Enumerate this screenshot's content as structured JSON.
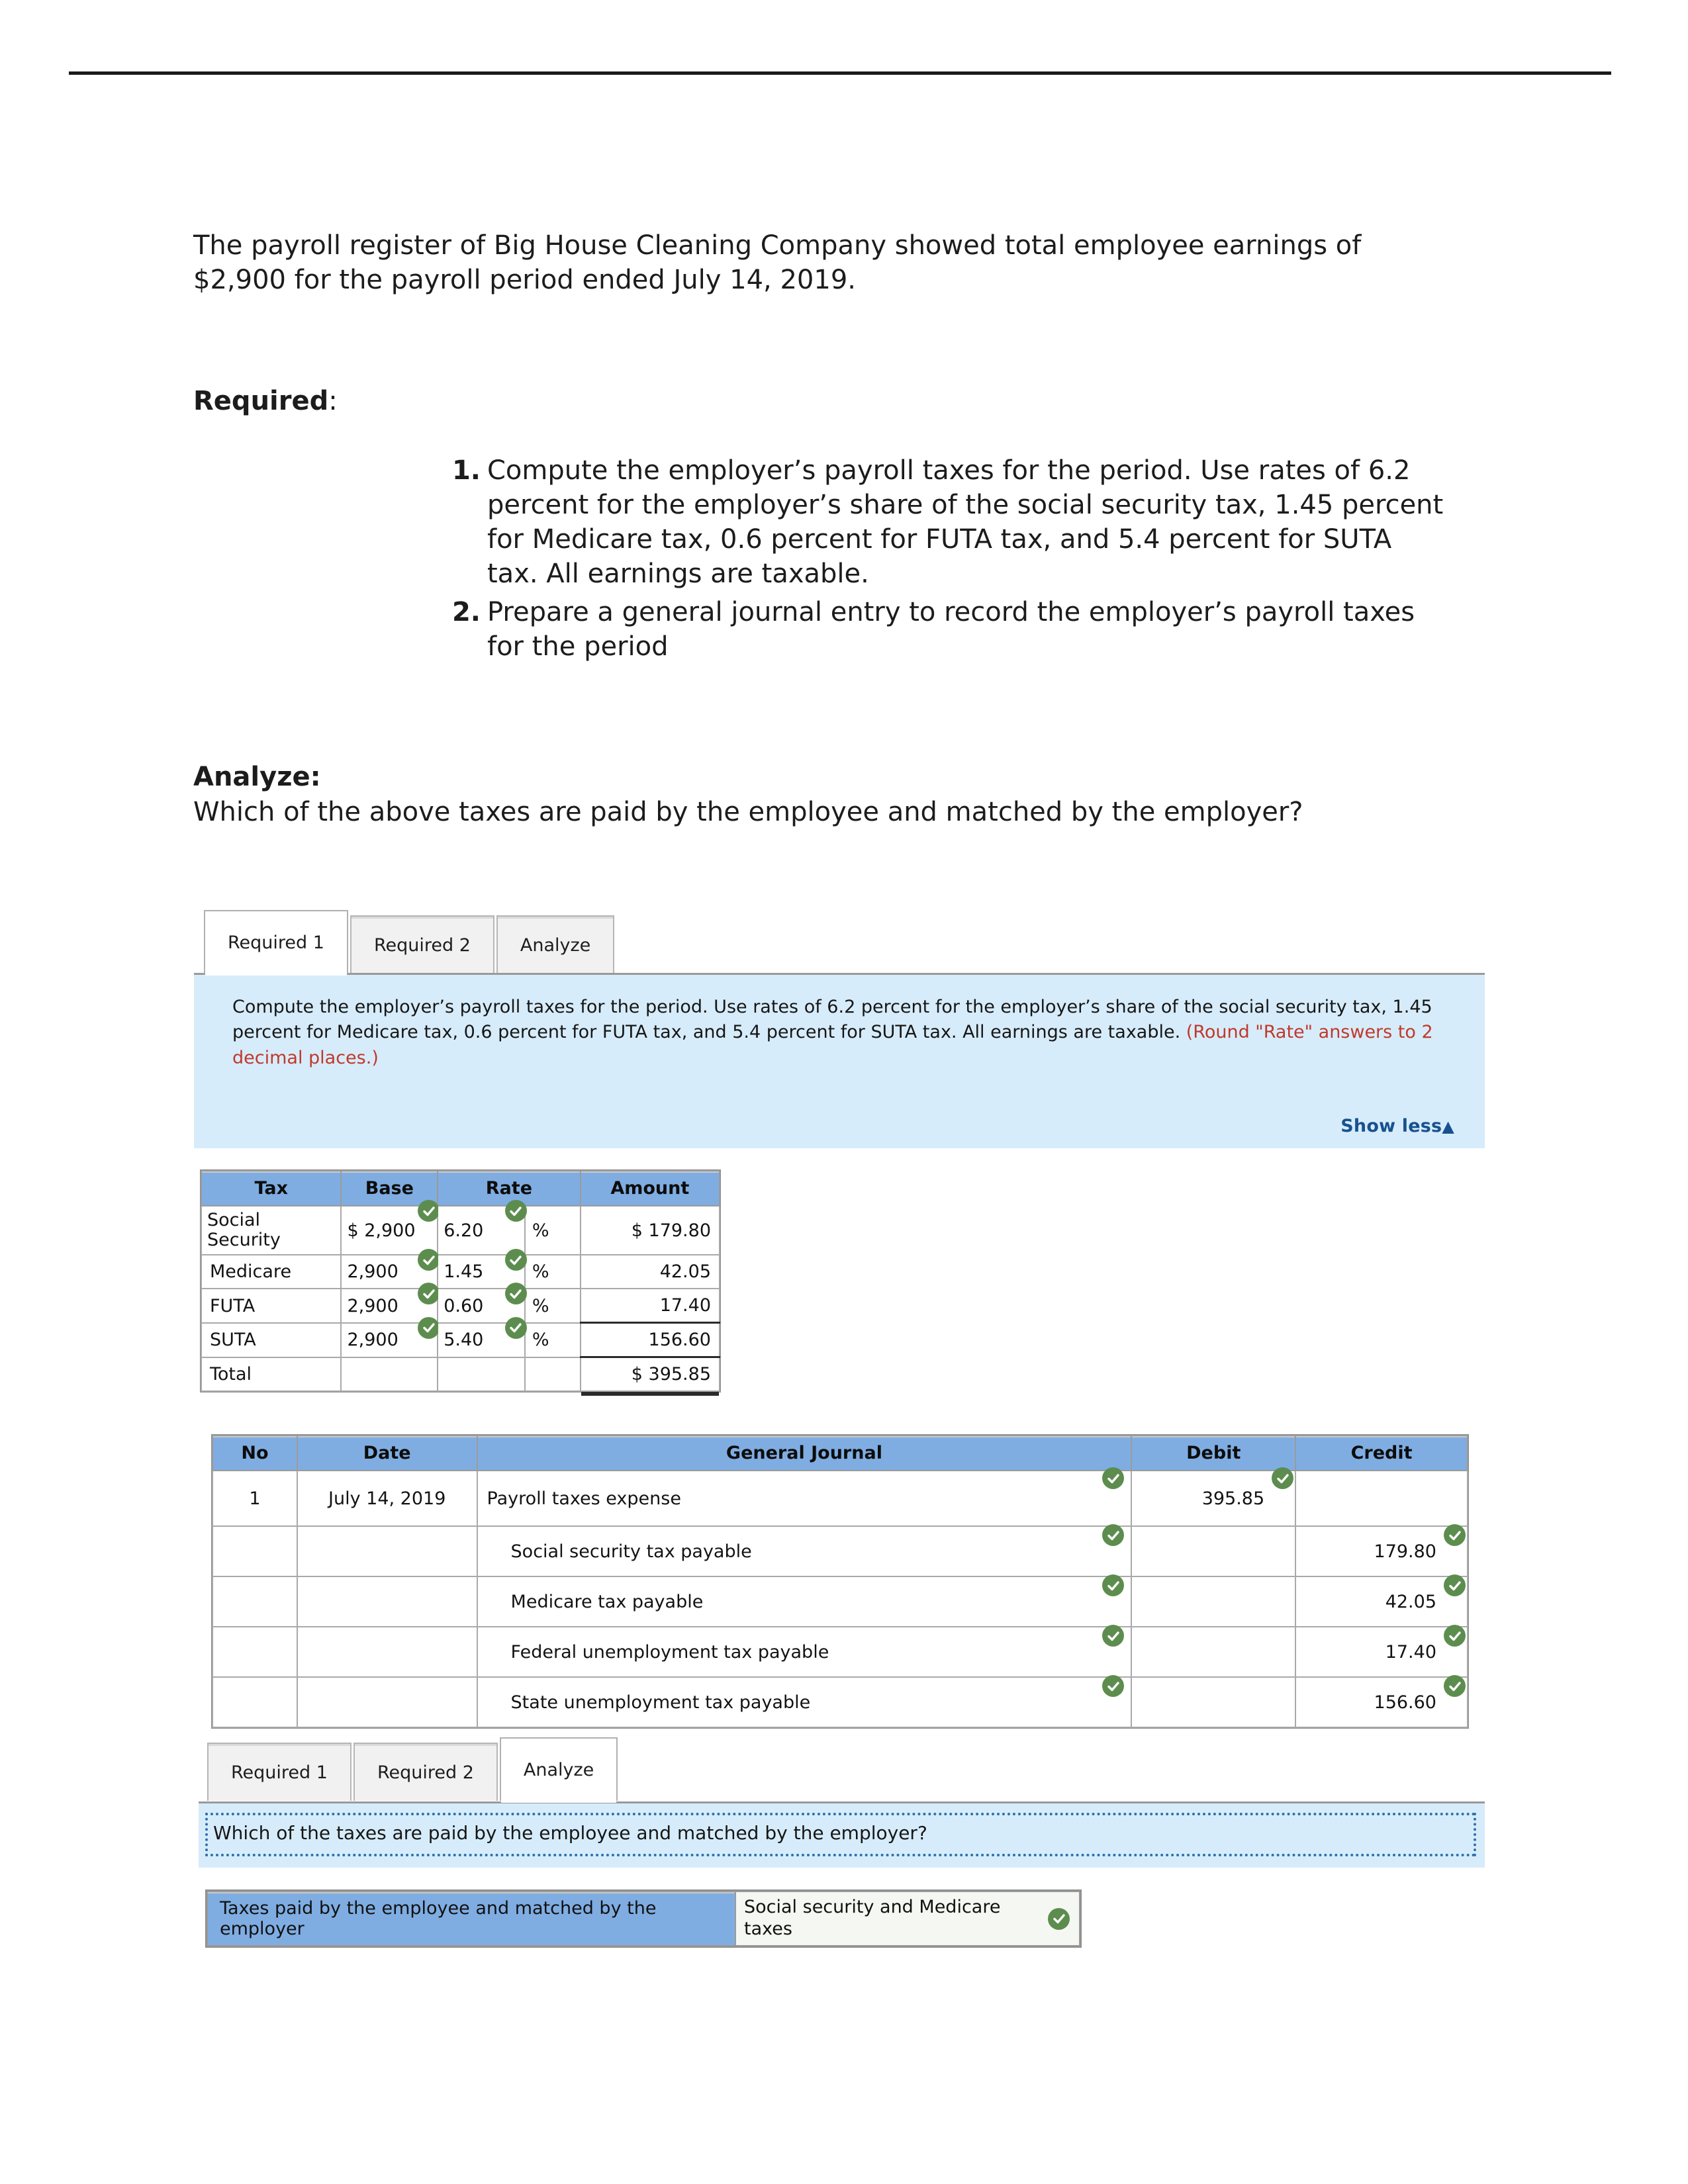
{
  "document": {
    "intro": "The payroll register of Big House Cleaning Company showed total employee earnings of $2,900 for the payroll period ended July 14, 2019.",
    "required_label": "Required",
    "required_colon": ":",
    "requirements": [
      {
        "num": "1.",
        "text": "Compute the employer’s payroll taxes for the period. Use rates of 6.2 percent for the employer’s share of the social security tax, 1.45 percent for Medicare tax, 0.6 percent for FUTA tax, and 5.4 percent for SUTA tax. All earnings are taxable."
      },
      {
        "num": "2.",
        "text": "Prepare a general journal entry to record the employer’s payroll taxes for the period"
      }
    ],
    "analyze_heading": "Analyze:",
    "analyze_question": "Which of the above taxes are paid by the employee and matched by the employer?"
  },
  "tabs_top": {
    "items": [
      {
        "label": "Required 1",
        "active": true
      },
      {
        "label": "Required 2",
        "active": false
      },
      {
        "label": "Analyze",
        "active": false
      }
    ]
  },
  "instruction_panel": {
    "text_main": "Compute the employer’s payroll taxes for the period. Use rates of 6.2 percent for the employer’s share of the social security tax, 1.45 percent for Medicare tax, 0.6 percent for FUTA tax, and 5.4 percent for SUTA tax. All earnings are taxable. ",
    "text_red": "(Round \"Rate\" answers to 2 decimal places.)",
    "show_less_label": "Show less",
    "show_less_caret": "▲"
  },
  "tax_table": {
    "headers": [
      "Tax",
      "Base",
      "Rate",
      "Amount"
    ],
    "percent_symbol": "%",
    "rows": [
      {
        "tax": "Social Security",
        "base": "$ 2,900",
        "rate": "6.20",
        "amount": "$ 179.80"
      },
      {
        "tax": "Medicare",
        "base": "2,900",
        "rate": "1.45",
        "amount": "42.05"
      },
      {
        "tax": "FUTA",
        "base": "2,900",
        "rate": "0.60",
        "amount": "17.40"
      },
      {
        "tax": "SUTA",
        "base": "2,900",
        "rate": "5.40",
        "amount": "156.60"
      }
    ],
    "total_label": "Total",
    "total_amount": "$ 395.85"
  },
  "journal_table": {
    "headers": [
      "No",
      "Date",
      "General Journal",
      "Debit",
      "Credit"
    ],
    "rows": [
      {
        "no": "1",
        "date": "July 14, 2019",
        "account": "Payroll taxes expense",
        "debit": "395.85",
        "credit": "",
        "indent": false
      },
      {
        "no": "",
        "date": "",
        "account": "Social security tax payable",
        "debit": "",
        "credit": "179.80",
        "indent": true
      },
      {
        "no": "",
        "date": "",
        "account": "Medicare tax payable",
        "debit": "",
        "credit": "42.05",
        "indent": true
      },
      {
        "no": "",
        "date": "",
        "account": "Federal unemployment tax payable",
        "debit": "",
        "credit": "17.40",
        "indent": true
      },
      {
        "no": "",
        "date": "",
        "account": "State unemployment tax payable",
        "debit": "",
        "credit": "156.60",
        "indent": true
      }
    ]
  },
  "tabs_bottom": {
    "items": [
      {
        "label": "Required 1",
        "active": false
      },
      {
        "label": "Required 2",
        "active": false
      },
      {
        "label": "Analyze",
        "active": true
      }
    ]
  },
  "analyze_panel": {
    "question": "Which of the taxes are paid by the employee and matched by the employer?",
    "answer_label": "Taxes paid by the employee and matched by the employer",
    "answer_value": "Social security and Medicare taxes"
  },
  "colors": {
    "header_blue": "#7FADE2",
    "panel_blue": "#d7ecfa",
    "check_green": "#5d8d4e",
    "red_note": "#c0392b",
    "link_blue": "#17518f"
  }
}
